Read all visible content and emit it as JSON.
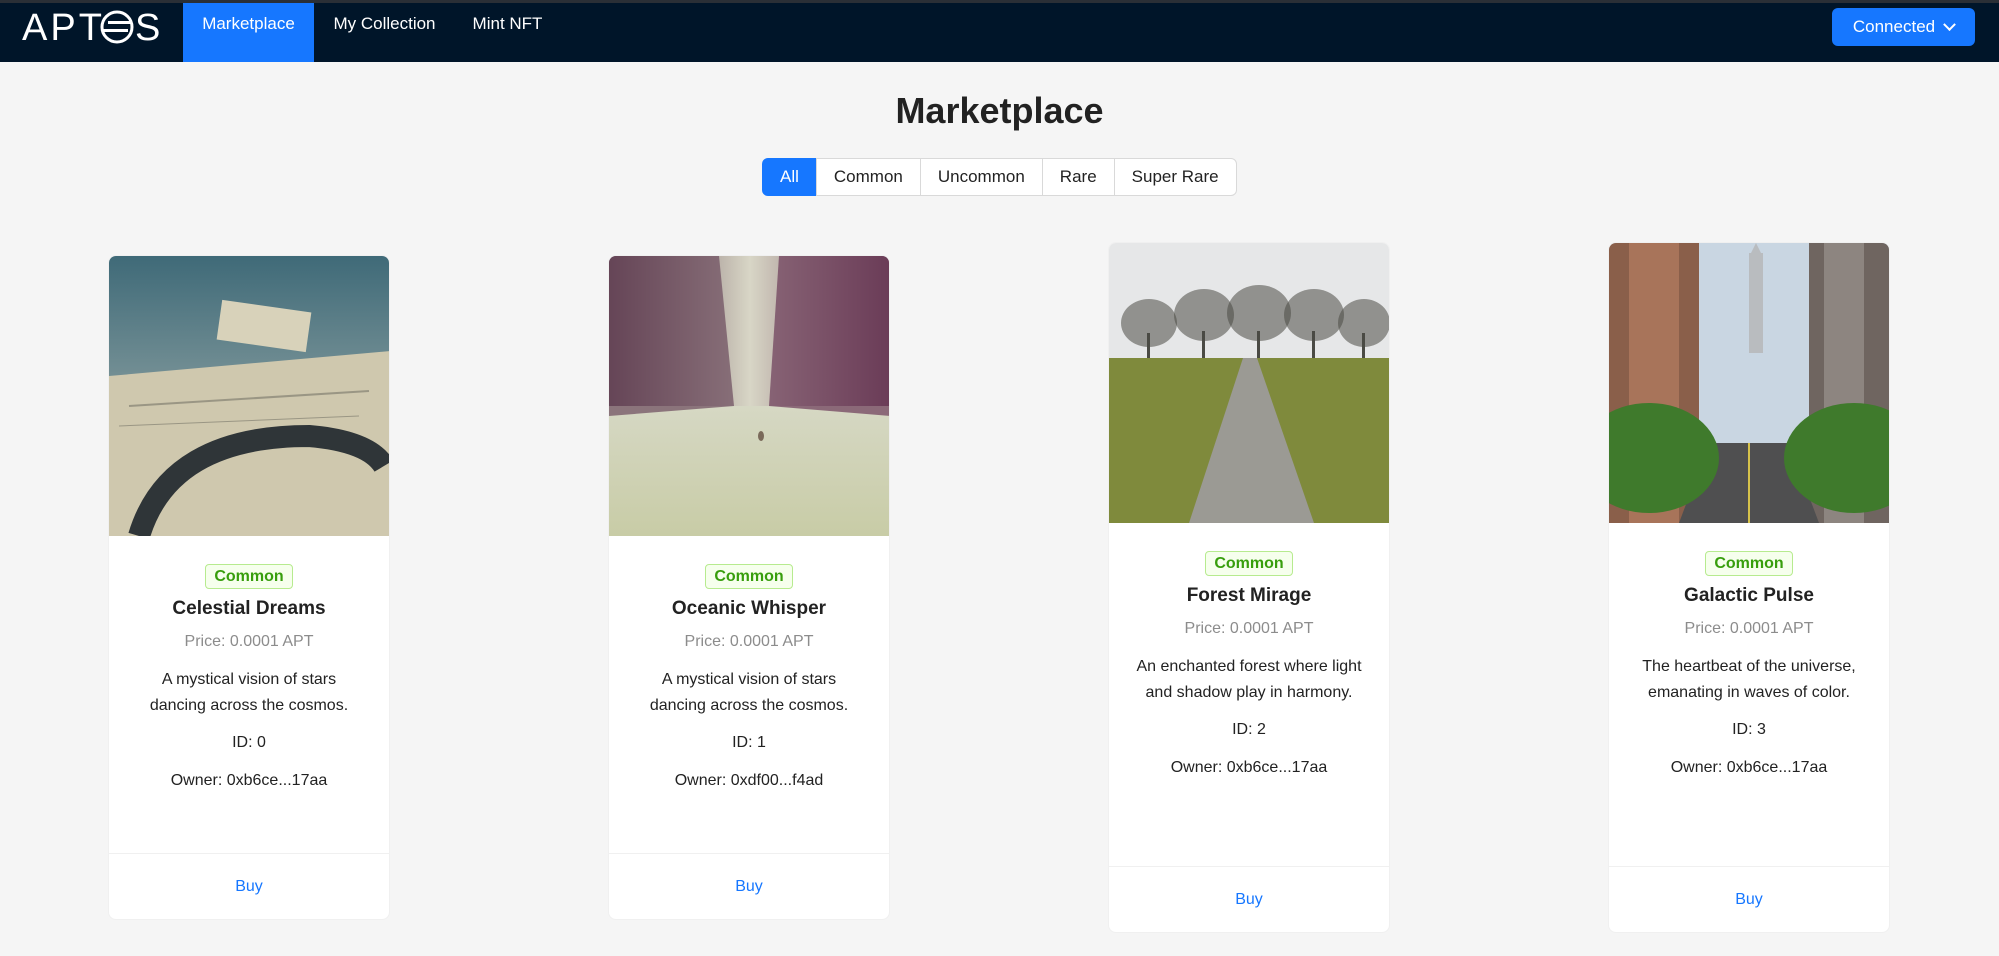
{
  "app": {
    "logo_text": "APTOS"
  },
  "nav": {
    "items": [
      {
        "label": "Marketplace"
      },
      {
        "label": "My Collection"
      },
      {
        "label": "Mint NFT"
      }
    ],
    "connect_label": "Connected"
  },
  "page": {
    "title": "Marketplace"
  },
  "filters": {
    "options": [
      {
        "label": "All"
      },
      {
        "label": "Common"
      },
      {
        "label": "Uncommon"
      },
      {
        "label": "Rare"
      },
      {
        "label": "Super Rare"
      }
    ],
    "selected": "All"
  },
  "cards": [
    {
      "rarity": "Common",
      "name": "Celestial Dreams",
      "price": "Price: 0.0001 APT",
      "description": "A mystical vision of stars dancing across the cosmos.",
      "id": "ID: 0",
      "owner": "Owner: 0xb6ce...17aa",
      "action": "Buy"
    },
    {
      "rarity": "Common",
      "name": "Oceanic Whisper",
      "price": "Price: 0.0001 APT",
      "description": "A mystical vision of stars dancing across the cosmos.",
      "id": "ID: 1",
      "owner": "Owner: 0xdf00...f4ad",
      "action": "Buy"
    },
    {
      "rarity": "Common",
      "name": "Forest Mirage",
      "price": "Price: 0.0001 APT",
      "description": "An enchanted forest where light and shadow play in harmony.",
      "id": "ID: 2",
      "owner": "Owner: 0xb6ce...17aa",
      "action": "Buy"
    },
    {
      "rarity": "Common",
      "name": "Galactic Pulse",
      "price": "Price: 0.0001 APT",
      "description": "The heartbeat of the universe, emanating in waves of color.",
      "id": "ID: 3",
      "owner": "Owner: 0xb6ce...17aa",
      "action": "Buy"
    }
  ],
  "colors": {
    "header_bg": "#001529",
    "primary": "#1677ff",
    "badge_green": "#389e0d"
  }
}
